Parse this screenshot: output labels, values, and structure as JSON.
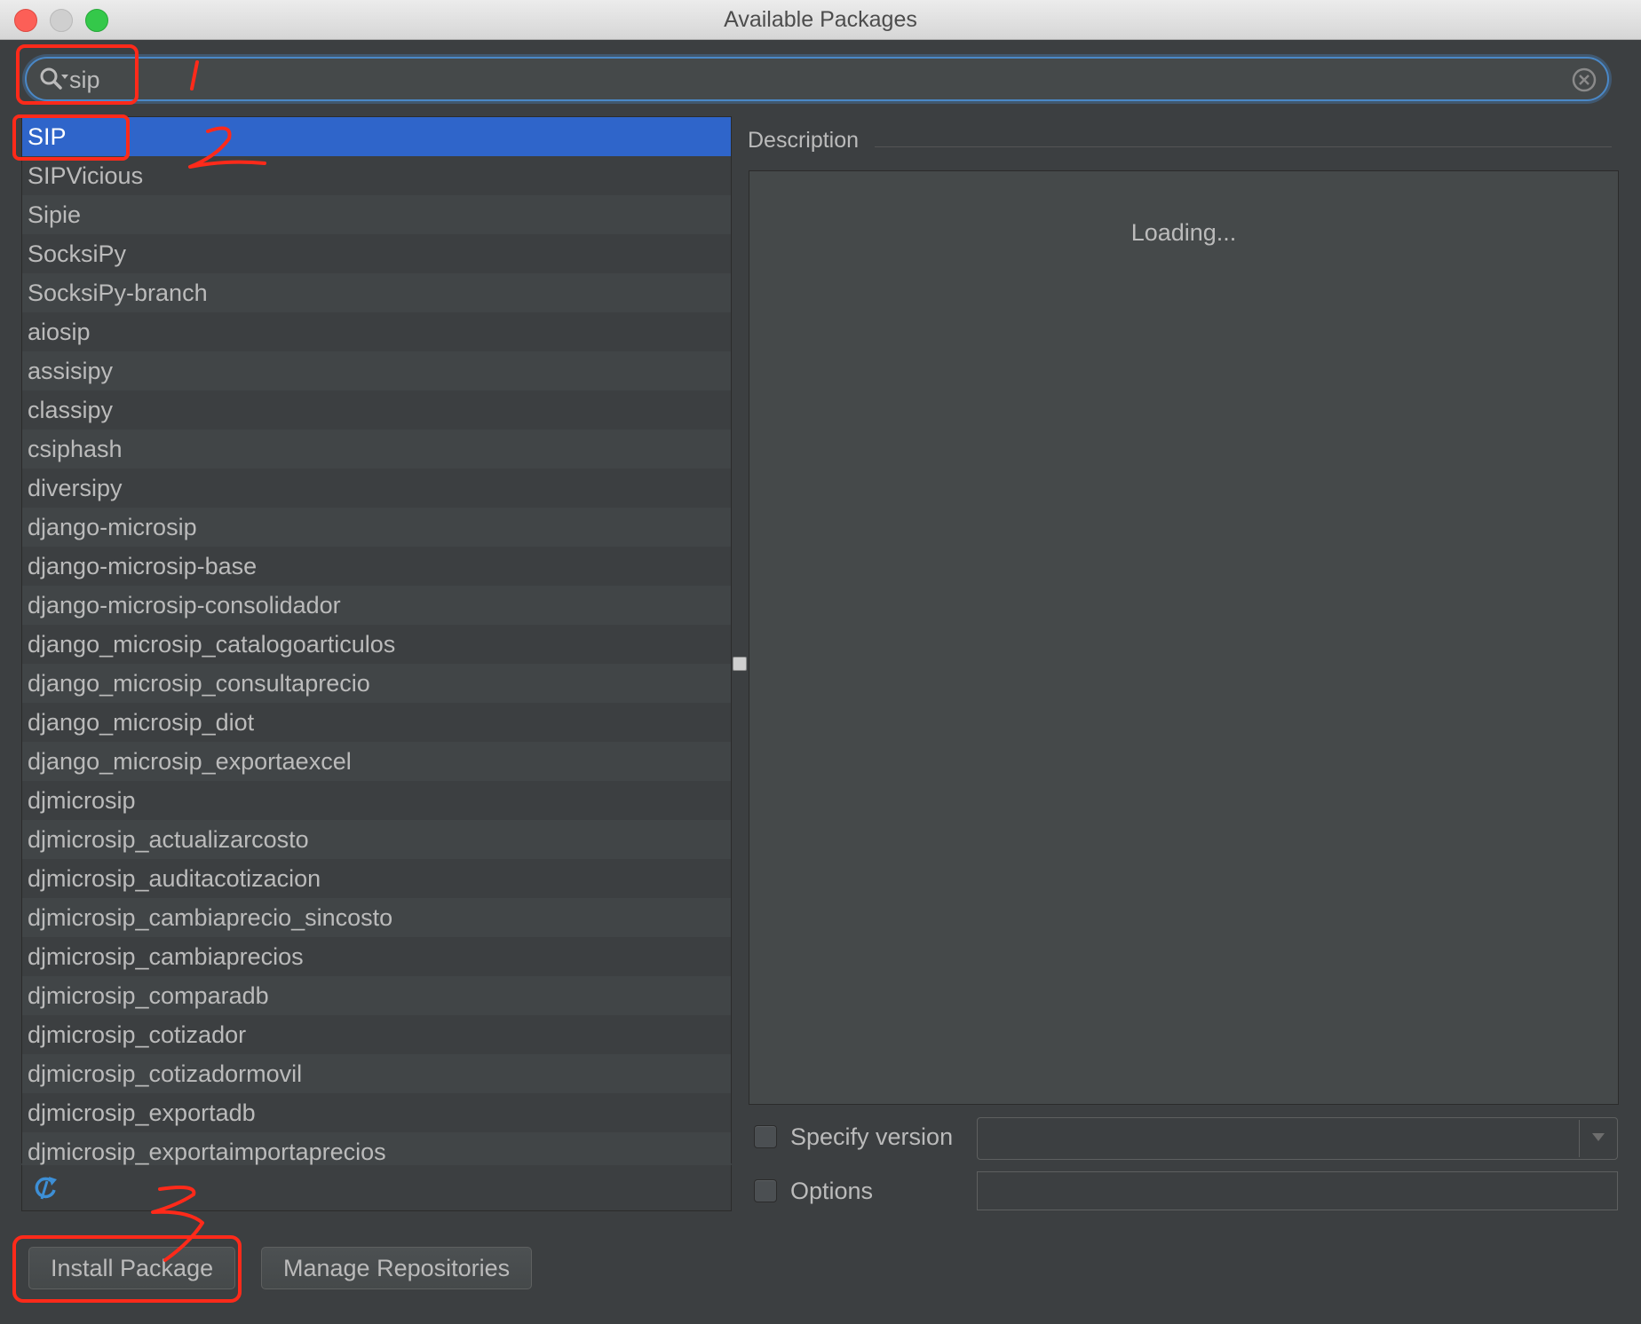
{
  "window": {
    "title": "Available Packages"
  },
  "search": {
    "value": "sip",
    "placeholder": ""
  },
  "packages": {
    "selected_index": 0,
    "items": [
      "SIP",
      "SIPVicious",
      "Sipie",
      "SocksiPy",
      "SocksiPy-branch",
      "aiosip",
      "assisipy",
      "classipy",
      "csiphash",
      "diversipy",
      "django-microsip",
      "django-microsip-base",
      "django-microsip-consolidador",
      "django_microsip_catalogoarticulos",
      "django_microsip_consultaprecio",
      "django_microsip_diot",
      "django_microsip_exportaexcel",
      "djmicrosip",
      "djmicrosip_actualizarcosto",
      "djmicrosip_auditacotizacion",
      "djmicrosip_cambiaprecio_sincosto",
      "djmicrosip_cambiaprecios",
      "djmicrosip_comparadb",
      "djmicrosip_cotizador",
      "djmicrosip_cotizadormovil",
      "djmicrosip_exportadb",
      "djmicrosip_exportaimportaprecios"
    ]
  },
  "description": {
    "label": "Description",
    "loading_text": "Loading..."
  },
  "options": {
    "specify_version_label": "Specify version",
    "specify_version_checked": false,
    "version_value": "",
    "options_label": "Options",
    "options_checked": false,
    "options_value": ""
  },
  "buttons": {
    "install": "Install Package",
    "manage_repositories": "Manage Repositories"
  },
  "annotations": {
    "color": "#ff2a1a",
    "marks": [
      "1",
      "2",
      "3"
    ]
  },
  "colors": {
    "selection": "#2f65ca",
    "focus": "#4a88c7",
    "background": "#3c3f41"
  },
  "icons": {
    "search": "search-icon",
    "clear": "clear-search-icon",
    "refresh": "refresh-icon",
    "dropdown": "chevron-down-icon"
  }
}
